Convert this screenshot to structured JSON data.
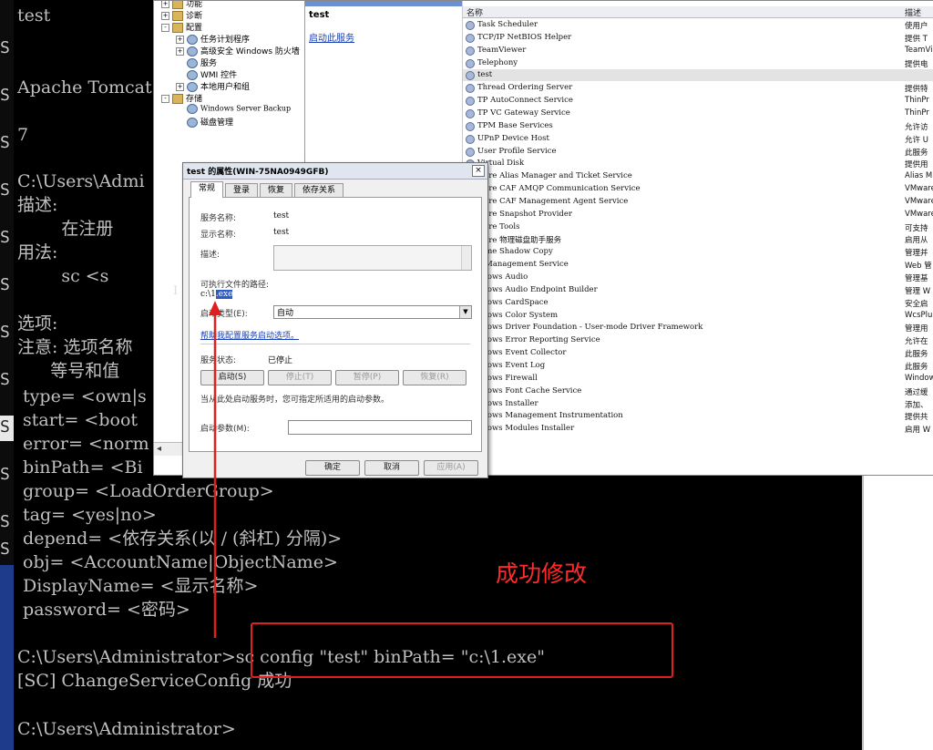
{
  "left_strip": {
    "glyphs": [
      "S",
      "S",
      "S",
      "S",
      "S",
      "S",
      "S",
      "S",
      "S",
      "S",
      "S",
      "S"
    ]
  },
  "console": {
    "lines": [
      "test",
      "Apache Tomcat",
      "7",
      "C:\\Users\\Admi",
      "描述:",
      "        在注册",
      "用法:",
      "        sc <s",
      "选项:",
      "注意: 选项名称",
      "      等号和值",
      " type= <own|s",
      " start= <boot",
      " error= <norm",
      " binPath= <Bi",
      " group= <LoadOrderGroup>",
      " tag= <yes|no>",
      " depend= <依存关系(以 / (斜杠) 分隔)>",
      " obj= <AccountName|ObjectName>",
      " DisplayName= <显示名称>",
      " password= <密码>",
      "C:\\Users\\Administrator>sc config \"test\" binPath= \"c:\\1.exe\"",
      "[SC] ChangeServiceConfig 成功",
      "C:\\Users\\Administrator>"
    ]
  },
  "tree": {
    "items": [
      {
        "label": "功能",
        "expand": "+"
      },
      {
        "label": "诊断",
        "expand": "+"
      },
      {
        "label": "配置",
        "expand": "-"
      },
      {
        "label": "任务计划程序",
        "expand": "+"
      },
      {
        "label": "高级安全 Windows 防火墙",
        "expand": "+"
      },
      {
        "label": "服务",
        "expand": ""
      },
      {
        "label": "WMI 控件",
        "expand": ""
      },
      {
        "label": "本地用户和组",
        "expand": "+"
      },
      {
        "label": "存储",
        "expand": "-"
      },
      {
        "label": "Windows Server Backup",
        "expand": ""
      },
      {
        "label": "磁盘管理",
        "expand": ""
      }
    ]
  },
  "desc_pane": {
    "title": "test",
    "start_link": "启动此服务"
  },
  "services": {
    "col_name": "名称",
    "col_desc": "描述",
    "rows": [
      {
        "name": "Task Scheduler",
        "desc": "使用户"
      },
      {
        "name": "TCP/IP NetBIOS Helper",
        "desc": "提供 T"
      },
      {
        "name": "TeamViewer",
        "desc": "TeamVi"
      },
      {
        "name": "Telephony",
        "desc": "提供电"
      },
      {
        "name": "test",
        "desc": ""
      },
      {
        "name": "Thread Ordering Server",
        "desc": "提供特"
      },
      {
        "name": "TP AutoConnect Service",
        "desc": "ThinPr"
      },
      {
        "name": "TP VC Gateway Service",
        "desc": "ThinPr"
      },
      {
        "name": "TPM Base Services",
        "desc": "允许访"
      },
      {
        "name": "UPnP Device Host",
        "desc": "允许 U"
      },
      {
        "name": "User Profile Service",
        "desc": "此服务"
      },
      {
        "name": "Virtual Disk",
        "desc": "提供用"
      },
      {
        "name": "ware Alias Manager and Ticket Service",
        "desc": "Alias M"
      },
      {
        "name": "ware CAF AMQP Communication Service",
        "desc": "VMware"
      },
      {
        "name": "ware CAF Management Agent Service",
        "desc": "VMware"
      },
      {
        "name": "ware Snapshot Provider",
        "desc": "VMware"
      },
      {
        "name": "ware Tools",
        "desc": "可支持"
      },
      {
        "name": "ware 物理磁盘助手服务",
        "desc": "启用从"
      },
      {
        "name": "lume Shadow Copy",
        "desc": "管理并"
      },
      {
        "name": "b Management Service",
        "desc": "Web 管"
      },
      {
        "name": "ndows Audio",
        "desc": "管理基"
      },
      {
        "name": "ndows Audio Endpoint Builder",
        "desc": "管理 W"
      },
      {
        "name": "ndows CardSpace",
        "desc": "安全启"
      },
      {
        "name": "ndows Color System",
        "desc": "WcsPlu"
      },
      {
        "name": "ndows Driver Foundation - User-mode Driver Framework",
        "desc": "管理用"
      },
      {
        "name": "ndows Error Reporting Service",
        "desc": "允许在"
      },
      {
        "name": "ndows Event Collector",
        "desc": "此服务"
      },
      {
        "name": "ndows Event Log",
        "desc": "此服务"
      },
      {
        "name": "ndows Firewall",
        "desc": "Window"
      },
      {
        "name": "ndows Font Cache Service",
        "desc": "通过缓"
      },
      {
        "name": "ndows Installer",
        "desc": "添加、"
      },
      {
        "name": "ndows Management Instrumentation",
        "desc": "提供共"
      },
      {
        "name": "ndows Modules Installer",
        "desc": "启用 W"
      }
    ]
  },
  "dialog": {
    "title": "test 的属性(WIN-75NA0949GFB)",
    "close": "×",
    "tabs": [
      "常规",
      "登录",
      "恢复",
      "依存关系"
    ],
    "service_name_label": "服务名称:",
    "service_name": "test",
    "display_name_label": "显示名称:",
    "display_name": "test",
    "description_label": "描述:",
    "path_label": "可执行文件的路径:",
    "path_prefix": "c:\\1",
    "path_selected": ".exe",
    "startup_type_label": "启动类型(E):",
    "startup_type": "自动",
    "help_link": "帮助我配置服务启动选项。",
    "status_label": "服务状态:",
    "status": "已停止",
    "buttons": {
      "start": "启动(S)",
      "stop": "停止(T)",
      "pause": "暂停(P)",
      "resume": "恢复(R)"
    },
    "hint": "当从此处启动服务时，您可指定所适用的启动参数。",
    "param_label": "启动参数(M):",
    "ok": "确定",
    "cancel": "取消",
    "apply": "应用(A)"
  },
  "annotation": {
    "text": "成功修改",
    "color": "#ff2a2a"
  }
}
